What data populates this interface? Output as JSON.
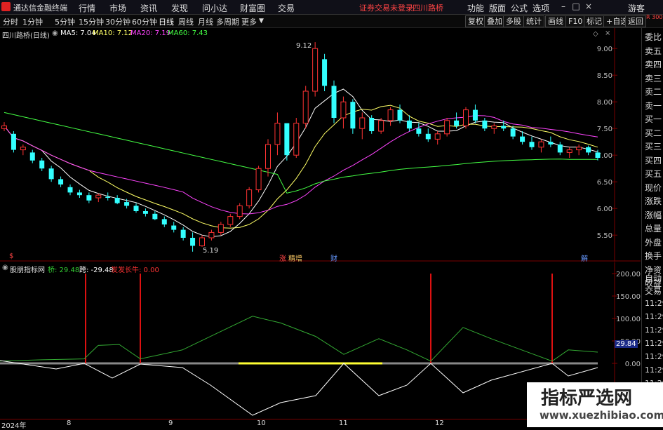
{
  "app": {
    "name": "通达信金融终端"
  },
  "menu": [
    "行情",
    "市场",
    "资讯",
    "发现",
    "问小达",
    "财富圈",
    "交易"
  ],
  "status": {
    "login": "证券交易未登录",
    "stock": "四川路桥"
  },
  "right_menu": [
    "功能",
    "版面",
    "公式",
    "选项"
  ],
  "guest": "游客",
  "periods": [
    "分时",
    "1分钟",
    "5分钟",
    "15分钟",
    "30分钟",
    "60分钟",
    "日线",
    "周线",
    "月线",
    "多周期",
    "更多"
  ],
  "active_period": "日线",
  "toolbar_right": [
    "复权",
    "叠加",
    "多股",
    "统计",
    "画线",
    "F10",
    "标记",
    "+自选",
    "返回"
  ],
  "main": {
    "title": "四川路桥(日线)",
    "ma": [
      {
        "label": "MA5: 7.04",
        "color": "#ffffff"
      },
      {
        "label": "MA10: 7.12",
        "color": "#ffff66"
      },
      {
        "label": "MA20: 7.19",
        "color": "#ff44ff"
      },
      {
        "label": "MA60: 7.43",
        "color": "#44ff44"
      }
    ],
    "y_ticks": [
      "9.00",
      "8.50",
      "8.00",
      "7.50",
      "7.00",
      "6.50",
      "6.00",
      "5.50"
    ],
    "high_label": "9.12",
    "low_label": "5.19",
    "events": [
      {
        "text": "涨",
        "color": "#ff4444"
      },
      {
        "text": "精增",
        "color": "#ffcc66"
      },
      {
        "text": "财",
        "color": "#6699ff"
      },
      {
        "text": "解",
        "color": "#6699ff"
      },
      {
        "text": "$",
        "color": "#ff4444"
      }
    ]
  },
  "sub": {
    "title": "股朋指标网",
    "legend": [
      {
        "label": "桥: 29.48",
        "color": "#33cc33"
      },
      {
        "label": "跨: -29.48",
        "color": "#ffffff"
      },
      {
        "label": "发发长牛: 0.00",
        "color": "#ff3333"
      }
    ],
    "y_ticks": [
      "200.00",
      "150.00",
      "100.00",
      "50.00",
      "0.00"
    ],
    "current_value": "29.84"
  },
  "xaxis": [
    "2024年",
    "8",
    "9",
    "10",
    "11",
    "12"
  ],
  "right_panel": {
    "items": [
      "委比",
      "卖五",
      "卖四",
      "卖三",
      "卖二",
      "卖一",
      "买一",
      "买二",
      "买三",
      "买四",
      "买五",
      "现价",
      "涨跌",
      "涨幅",
      "总量",
      "外盘",
      "换手",
      "净资",
      "收益",
      "自动",
      "交易"
    ],
    "times": [
      "11:29",
      "11:29",
      "11:29",
      "11:29",
      "11:29",
      "11:29",
      "11:29",
      "11:29",
      "11:29",
      "11:29"
    ],
    "top_badge": "R 300"
  },
  "watermark": {
    "title": "指标严选网",
    "url": "www.xuezhibiao.com"
  },
  "chart_data": {
    "type": "candlestick",
    "title": "四川路桥(日线)",
    "ylim": [
      5.2,
      9.2
    ],
    "series_ohlc_points": [
      [
        7.5,
        7.62,
        7.45,
        7.55
      ],
      [
        7.4,
        7.45,
        7.05,
        7.1
      ],
      [
        7.1,
        7.2,
        7.0,
        7.15
      ],
      [
        7.05,
        7.1,
        6.85,
        6.9
      ],
      [
        6.9,
        6.95,
        6.7,
        6.75
      ],
      [
        6.75,
        6.8,
        6.5,
        6.55
      ],
      [
        6.55,
        6.6,
        6.4,
        6.45
      ],
      [
        6.4,
        6.45,
        6.25,
        6.3
      ],
      [
        6.3,
        6.35,
        6.2,
        6.25
      ],
      [
        6.25,
        6.3,
        6.1,
        6.15
      ],
      [
        6.2,
        6.28,
        6.12,
        6.25
      ],
      [
        6.22,
        6.3,
        6.15,
        6.2
      ],
      [
        6.2,
        6.25,
        6.08,
        6.1
      ],
      [
        6.12,
        6.18,
        6.0,
        6.05
      ],
      [
        6.05,
        6.1,
        5.92,
        5.95
      ],
      [
        5.95,
        6.0,
        5.85,
        5.9
      ],
      [
        5.9,
        5.95,
        5.78,
        5.8
      ],
      [
        5.8,
        5.85,
        5.65,
        5.7
      ],
      [
        5.68,
        5.75,
        5.55,
        5.6
      ],
      [
        5.6,
        5.65,
        5.4,
        5.45
      ],
      [
        5.45,
        5.55,
        5.19,
        5.3
      ],
      [
        5.3,
        5.5,
        5.28,
        5.45
      ],
      [
        5.45,
        5.6,
        5.4,
        5.55
      ],
      [
        5.55,
        5.75,
        5.5,
        5.7
      ],
      [
        5.7,
        5.9,
        5.65,
        5.85
      ],
      [
        5.85,
        6.1,
        5.8,
        6.05
      ],
      [
        6.05,
        6.4,
        6.0,
        6.35
      ],
      [
        6.35,
        6.8,
        6.3,
        6.75
      ],
      [
        6.75,
        7.3,
        6.6,
        7.2
      ],
      [
        7.2,
        7.8,
        7.0,
        7.6
      ],
      [
        7.6,
        7.4,
        6.9,
        7.0
      ],
      [
        7.0,
        7.7,
        6.95,
        7.6
      ],
      [
        7.6,
        8.3,
        7.5,
        8.2
      ],
      [
        8.2,
        9.12,
        8.1,
        9.0
      ],
      [
        8.8,
        8.9,
        8.2,
        8.3
      ],
      [
        8.3,
        8.4,
        7.6,
        7.7
      ],
      [
        7.7,
        8.1,
        7.5,
        8.0
      ],
      [
        8.0,
        8.05,
        7.4,
        7.5
      ],
      [
        7.5,
        7.8,
        7.3,
        7.7
      ],
      [
        7.7,
        7.75,
        7.4,
        7.45
      ],
      [
        7.45,
        7.7,
        7.4,
        7.65
      ],
      [
        7.65,
        7.9,
        7.55,
        7.85
      ],
      [
        7.85,
        7.95,
        7.6,
        7.65
      ],
      [
        7.65,
        7.75,
        7.45,
        7.5
      ],
      [
        7.5,
        7.6,
        7.35,
        7.4
      ],
      [
        7.4,
        7.5,
        7.25,
        7.3
      ],
      [
        7.3,
        7.45,
        7.2,
        7.4
      ],
      [
        7.4,
        7.7,
        7.35,
        7.65
      ],
      [
        7.65,
        7.8,
        7.5,
        7.55
      ],
      [
        7.55,
        7.9,
        7.5,
        7.85
      ],
      [
        7.85,
        7.95,
        7.6,
        7.65
      ],
      [
        7.65,
        7.7,
        7.45,
        7.5
      ],
      [
        7.5,
        7.6,
        7.4,
        7.55
      ],
      [
        7.55,
        7.65,
        7.45,
        7.5
      ],
      [
        7.5,
        7.55,
        7.3,
        7.35
      ],
      [
        7.35,
        7.45,
        7.2,
        7.25
      ],
      [
        7.25,
        7.35,
        7.1,
        7.15
      ],
      [
        7.15,
        7.3,
        7.05,
        7.25
      ],
      [
        7.25,
        7.35,
        7.15,
        7.2
      ],
      [
        7.2,
        7.25,
        7.0,
        7.05
      ],
      [
        7.05,
        7.15,
        6.95,
        7.1
      ],
      [
        7.1,
        7.2,
        7.0,
        7.15
      ],
      [
        7.15,
        7.18,
        7.0,
        7.05
      ],
      [
        7.05,
        7.1,
        6.9,
        6.95
      ]
    ]
  }
}
